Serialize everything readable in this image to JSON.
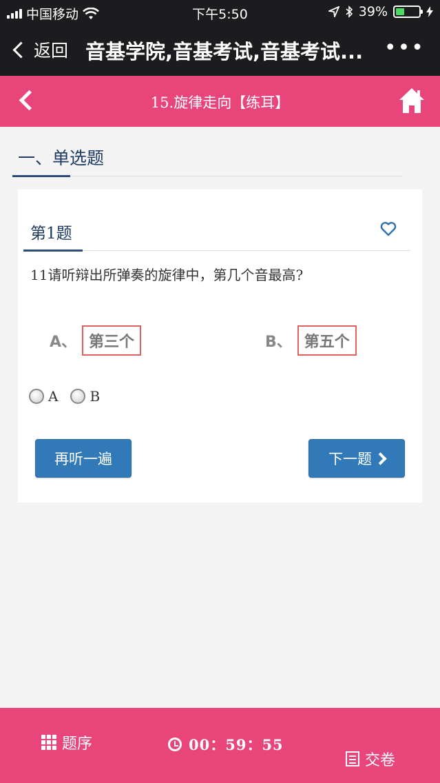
{
  "status_bar": {
    "carrier": "中国移动",
    "time": "下午5:50",
    "battery": "39%",
    "battery_level": 0.39
  },
  "wechat_bar": {
    "back_label": "返回",
    "title": "音基学院,音基考试,音基考试...",
    "more_label": "•••"
  },
  "header": {
    "title": "15.旋律走向【练耳】"
  },
  "section": {
    "title": "一、单选题"
  },
  "question": {
    "number_label": "第1题",
    "text": "11请听辩出所弹奏的旋律中，第几个音最高?",
    "options": [
      {
        "letter": "A、",
        "text": "第三个"
      },
      {
        "letter": "B、",
        "text": "第五个"
      }
    ],
    "radios": [
      {
        "label": "A"
      },
      {
        "label": "B"
      }
    ]
  },
  "buttons": {
    "replay": "再听一遍",
    "next": "下一题"
  },
  "bottom_bar": {
    "order_label": "题序",
    "timer": "00：59：55",
    "submit_label": "交卷"
  },
  "colors": {
    "accent_pink": "#e8457a",
    "button_blue": "#3279b7",
    "title_navy": "#1f3b63"
  }
}
